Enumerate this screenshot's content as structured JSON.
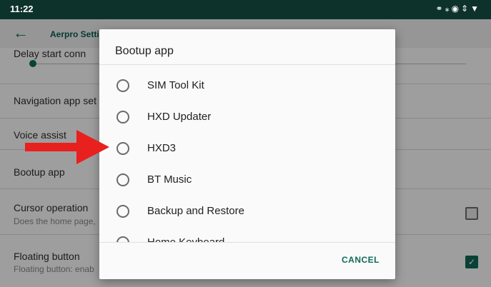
{
  "status": {
    "time": "11:22",
    "icons": [
      "headphones-icon",
      "bluetooth-icon",
      "location-icon",
      "data-icon",
      "wifi-icon"
    ]
  },
  "toolbar": {
    "title": "Aerpro Setti"
  },
  "settings": {
    "delay_title": "Delay start conn",
    "navigation_title": "Navigation app set",
    "voice_title": "Voice assist",
    "bootup_title": "Bootup app",
    "cursor_title": "Cursor operation",
    "cursor_summary": "Does the home page,",
    "cursor_checked": false,
    "floating_title": "Floating button",
    "floating_summary": "Floating button: enab",
    "floating_checked": true
  },
  "dialog": {
    "title": "Bootup app",
    "options": [
      "SIM Tool Kit",
      "HXD Updater",
      "HXD3",
      "BT Music",
      "Backup and Restore",
      "Home Keyboard"
    ],
    "cancel_label": "CANCEL"
  },
  "colors": {
    "accent": "#0a6e5c",
    "status_bar": "#0d322c",
    "annotation_arrow": "#e8201e"
  }
}
